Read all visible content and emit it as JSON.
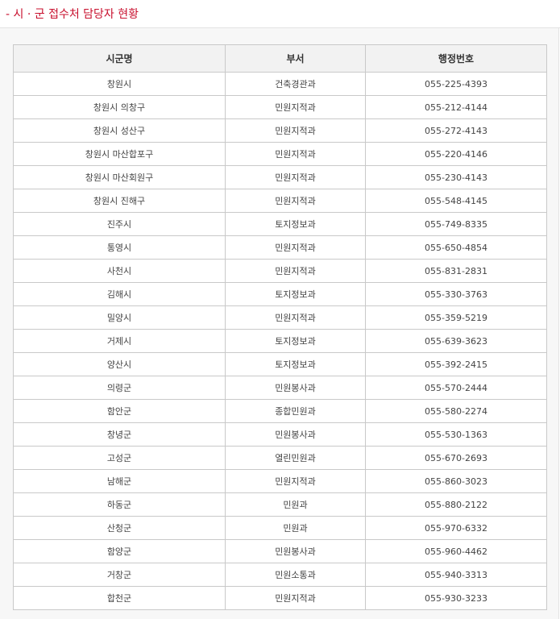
{
  "header": {
    "title": "- 시 · 군 접수처 담당자 현황",
    "accent_color": "#c8102e"
  },
  "table": {
    "columns": [
      "시군명",
      "부서",
      "행정번호"
    ],
    "rows": [
      [
        "창원시",
        "건축경관과",
        "055-225-4393"
      ],
      [
        "창원시 의창구",
        "민원지적과",
        "055-212-4144"
      ],
      [
        "창원시 성산구",
        "민원지적과",
        "055-272-4143"
      ],
      [
        "창원시 마산합포구",
        "민원지적과",
        "055-220-4146"
      ],
      [
        "창원시 마산회원구",
        "민원지적과",
        "055-230-4143"
      ],
      [
        "창원시 진해구",
        "민원지적과",
        "055-548-4145"
      ],
      [
        "진주시",
        "토지정보과",
        "055-749-8335"
      ],
      [
        "통영시",
        "민원지적과",
        "055-650-4854"
      ],
      [
        "사천시",
        "민원지적과",
        "055-831-2831"
      ],
      [
        "김해시",
        "토지정보과",
        "055-330-3763"
      ],
      [
        "밀양시",
        "민원지적과",
        "055-359-5219"
      ],
      [
        "거제시",
        "토지정보과",
        "055-639-3623"
      ],
      [
        "양산시",
        "토지정보과",
        "055-392-2415"
      ],
      [
        "의령군",
        "민원봉사과",
        "055-570-2444"
      ],
      [
        "함안군",
        "종합민원과",
        "055-580-2274"
      ],
      [
        "창녕군",
        "민원봉사과",
        "055-530-1363"
      ],
      [
        "고성군",
        "열린민원과",
        "055-670-2693"
      ],
      [
        "남해군",
        "민원지적과",
        "055-860-3023"
      ],
      [
        "하동군",
        "민원과",
        "055-880-2122"
      ],
      [
        "산청군",
        "민원과",
        "055-970-6332"
      ],
      [
        "함양군",
        "민원봉사과",
        "055-960-4462"
      ],
      [
        "거창군",
        "민원소통과",
        "055-940-3313"
      ],
      [
        "합천군",
        "민원지적과",
        "055-930-3233"
      ]
    ]
  }
}
